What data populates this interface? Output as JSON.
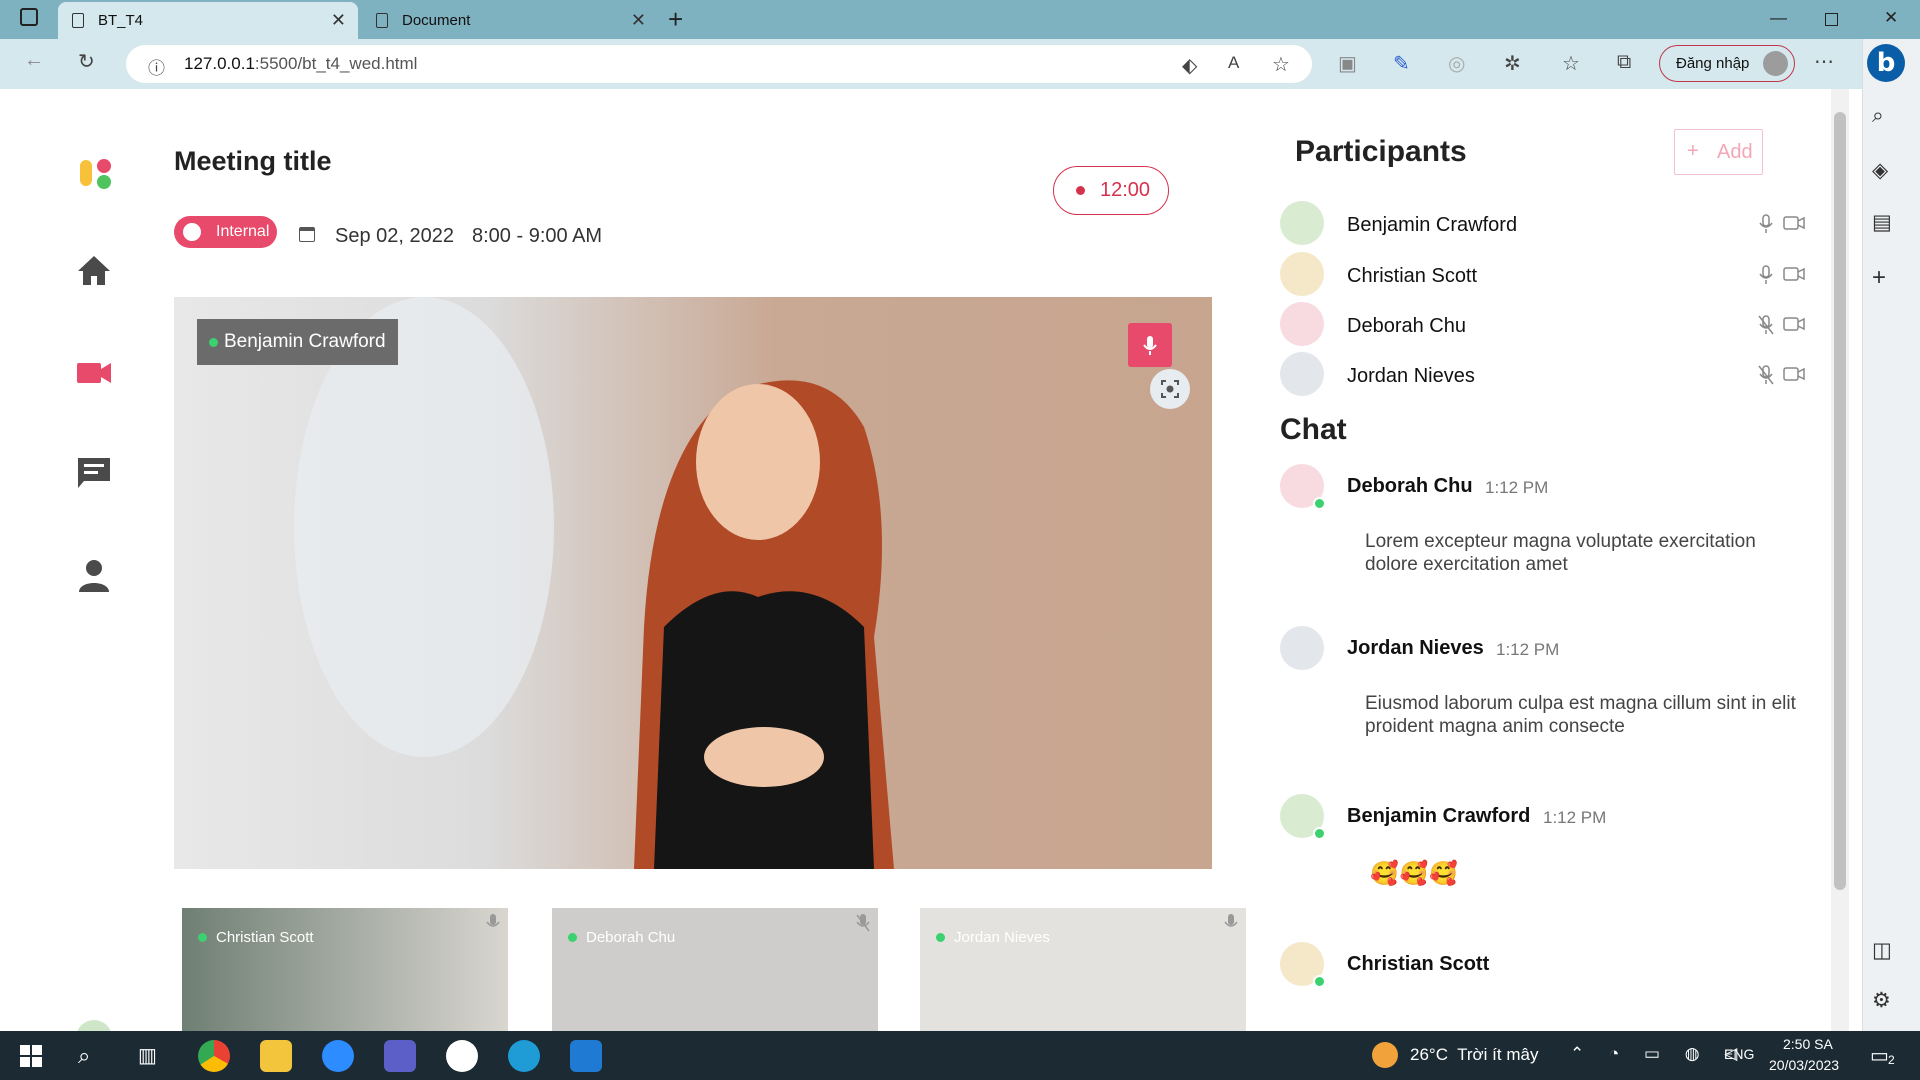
{
  "browser": {
    "tabs": [
      {
        "title": "BT_T4"
      },
      {
        "title": "Document"
      }
    ],
    "url_host": "127.0.0.1",
    "url_path": ":5500/bt_t4_wed.html",
    "login_label": "Đăng nhập"
  },
  "meeting": {
    "title": "Meeting title",
    "type_badge": "Internal",
    "date": "Sep 02, 2022",
    "time_range": "8:00 - 9:00 AM",
    "timer": "12:00",
    "main_speaker": "Benjamin Crawford",
    "thumbnails": [
      {
        "name": "Christian Scott",
        "mic": "on"
      },
      {
        "name": "Deborah Chu",
        "mic": "muted"
      },
      {
        "name": "Jordan Nieves",
        "mic": "on"
      }
    ]
  },
  "participants": {
    "title": "Participants",
    "add_label": "Add",
    "list": [
      {
        "name": "Benjamin Crawford",
        "mic": "on",
        "camera": "on"
      },
      {
        "name": "Christian Scott",
        "mic": "on",
        "camera": "on"
      },
      {
        "name": "Deborah Chu",
        "mic": "muted",
        "camera": "on"
      },
      {
        "name": "Jordan Nieves",
        "mic": "muted",
        "camera": "on"
      }
    ]
  },
  "chat": {
    "title": "Chat",
    "messages": [
      {
        "name": "Deborah Chu",
        "time": "1:12 PM",
        "text": "Lorem excepteur magna voluptate exercitation dolore exercitation amet"
      },
      {
        "name": "Jordan Nieves",
        "time": "1:12 PM",
        "text": "Eiusmod laborum culpa est magna cillum sint in elit proident magna anim consecte"
      },
      {
        "name": "Benjamin Crawford",
        "time": "1:12 PM",
        "text": "🥰🥰🥰"
      },
      {
        "name": "Christian Scott",
        "time": "",
        "text": ""
      }
    ]
  },
  "taskbar": {
    "weather": "26°C  Trời ít mây",
    "language": "ENG",
    "clock_time": "2:50 SA",
    "clock_date": "20/03/2023",
    "notifications": "2"
  },
  "colors": {
    "accent": "#e84a6b",
    "online": "#3bd16f",
    "icon": "#4a4a4a"
  }
}
